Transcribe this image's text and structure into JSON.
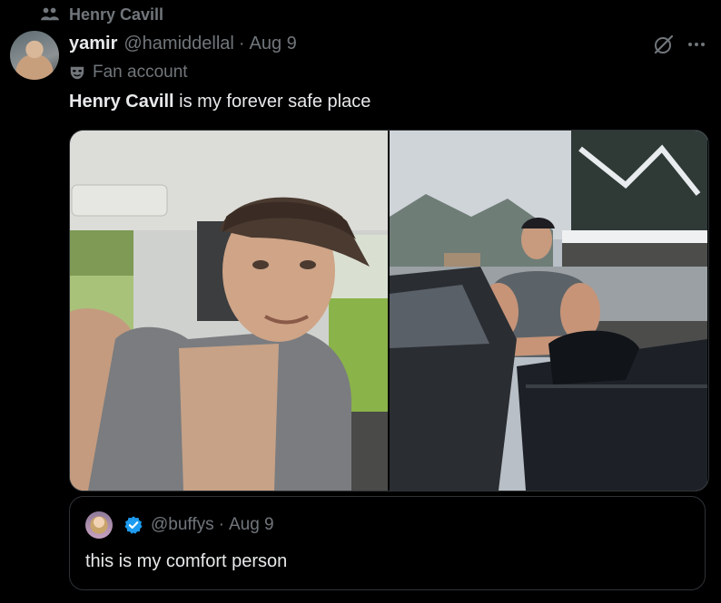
{
  "context": {
    "text": "Henry Cavill",
    "icon": "community-icon"
  },
  "tweet": {
    "author_name": "yamir",
    "handle": "@hamiddellal",
    "separator": "·",
    "date": "Aug 9",
    "label": "Fan account",
    "label_icon": "mask-icon",
    "text_bold": "Henry Cavill",
    "text_rest": " is my forever safe place"
  },
  "quote": {
    "handle": "@buffys",
    "separator": "·",
    "date": "Aug 9",
    "text": "this is my comfort person",
    "badge_icon": "verified-badge-icon"
  },
  "colors": {
    "background": "#000000",
    "text_primary": "#e7e9ea",
    "text_secondary": "#71767b",
    "border": "#2f3336",
    "verified": "#1d9bf0"
  }
}
